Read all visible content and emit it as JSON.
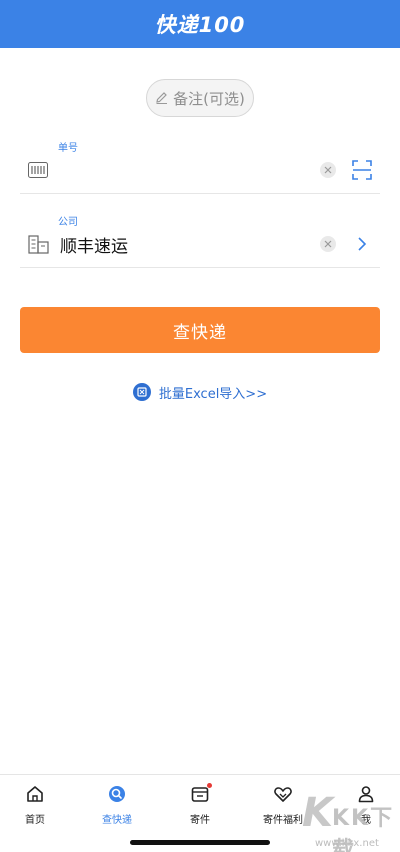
{
  "header": {
    "logo": "快递100"
  },
  "note_button": {
    "label": "备注(可选)"
  },
  "tracking_field": {
    "label": "单号",
    "value": ""
  },
  "company_field": {
    "label": "公司",
    "value": "顺丰速运"
  },
  "query_button": {
    "label": "查快递"
  },
  "import_link": {
    "label": "批量Excel导入>>"
  },
  "tabbar": {
    "tabs": [
      {
        "label": "首页",
        "icon": "home-icon"
      },
      {
        "label": "查快递",
        "icon": "search-icon",
        "active": true
      },
      {
        "label": "寄件",
        "icon": "send-package-icon"
      },
      {
        "label": "寄件福利",
        "icon": "gift-heart-icon"
      },
      {
        "label": "我",
        "icon": "user-icon"
      }
    ]
  },
  "watermark": {
    "text": "KK下载",
    "url": "www.kkx.net"
  },
  "colors": {
    "primary": "#3b82e6",
    "accent": "#fb8632"
  }
}
